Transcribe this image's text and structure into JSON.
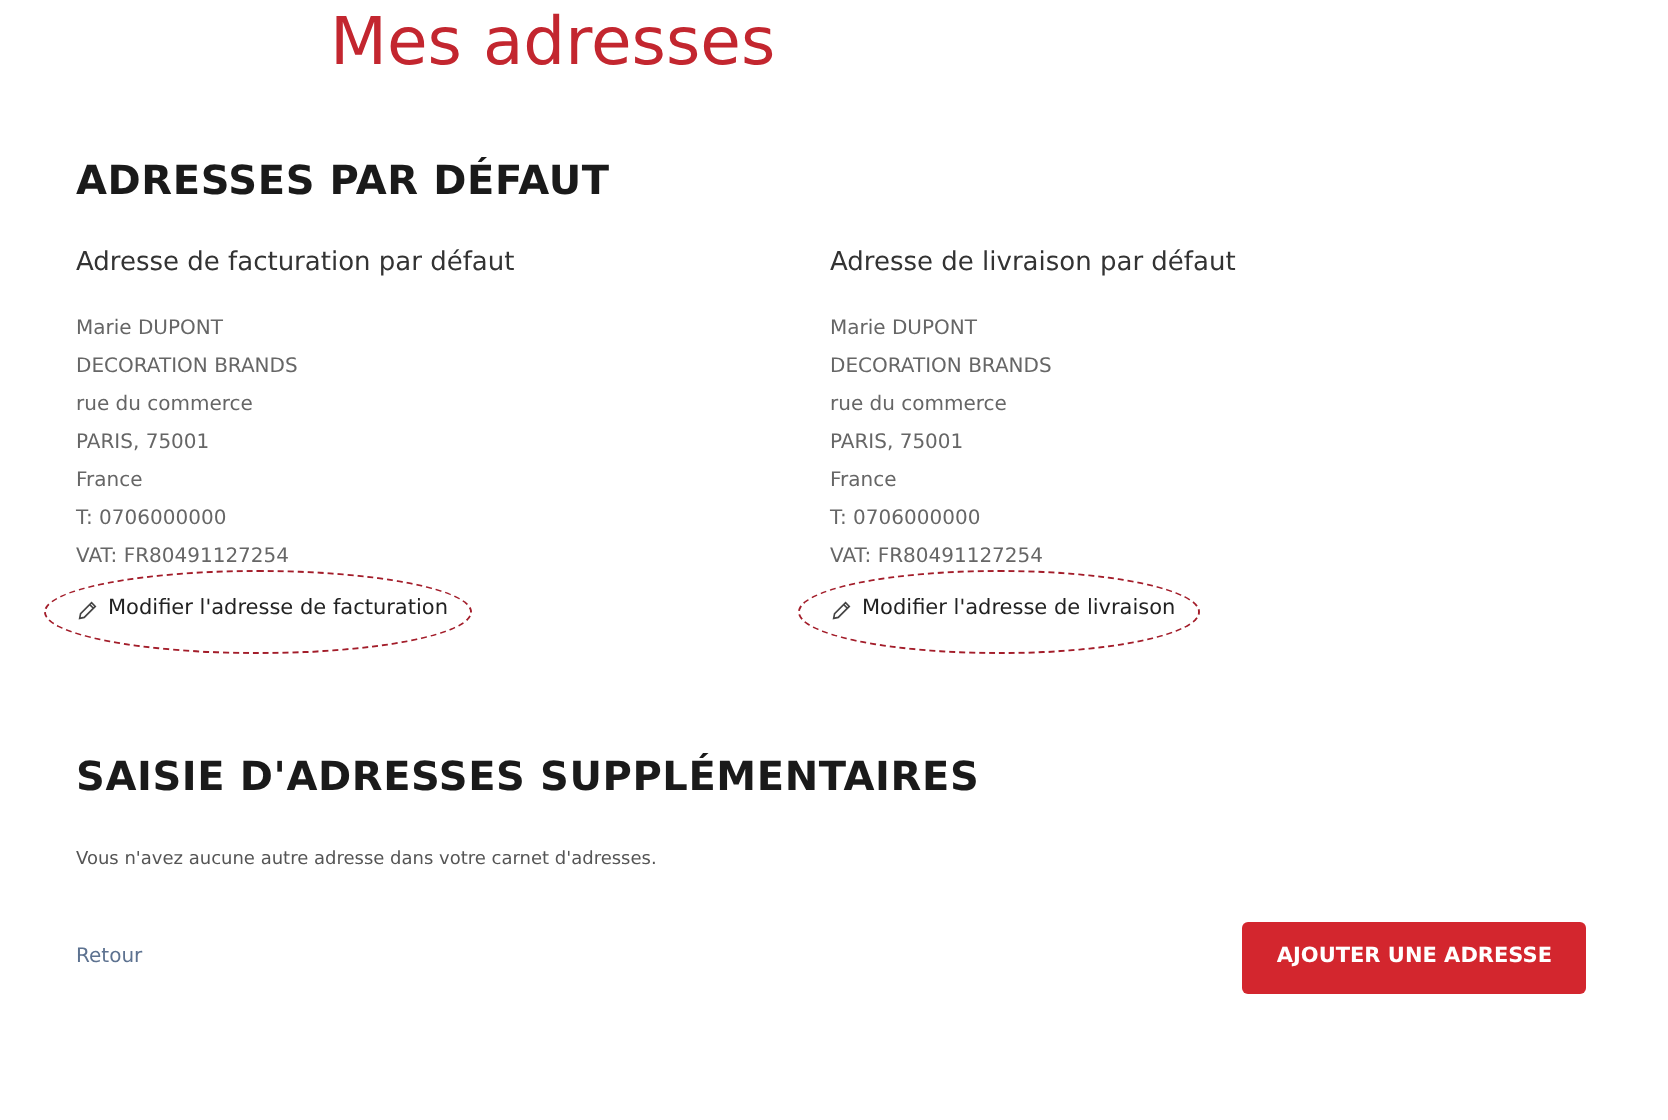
{
  "title": "Mes adresses",
  "default_section": {
    "heading": "ADRESSES PAR DÉFAUT",
    "addresses": [
      {
        "heading": "Adresse de facturation par défaut",
        "lines": [
          "Marie DUPONT",
          "DECORATION BRANDS",
          "rue du commerce",
          "PARIS, 75001",
          "France",
          "T: 0706000000",
          "VAT: FR80491127254"
        ],
        "edit_link": {
          "label": "Modifier l'adresse de facturation",
          "highlighted": true
        }
      },
      {
        "heading": "Adresse de livraison par défaut",
        "lines": [
          "Marie DUPONT",
          "DECORATION BRANDS",
          "rue du commerce",
          "PARIS, 75001",
          "France",
          "T: 0706000000",
          "VAT: FR80491127254"
        ],
        "edit_link": {
          "label": "Modifier l'adresse de livraison",
          "highlighted": true
        }
      }
    ]
  },
  "extra_section": {
    "heading": "SAISIE D'ADRESSES SUPPLÉMENTAIRES",
    "message": "Vous n'avez aucune autre adresse dans votre carnet d'adresses."
  },
  "back_link": "Retour",
  "add_button": "AJOUTER UNE ADRESSE"
}
